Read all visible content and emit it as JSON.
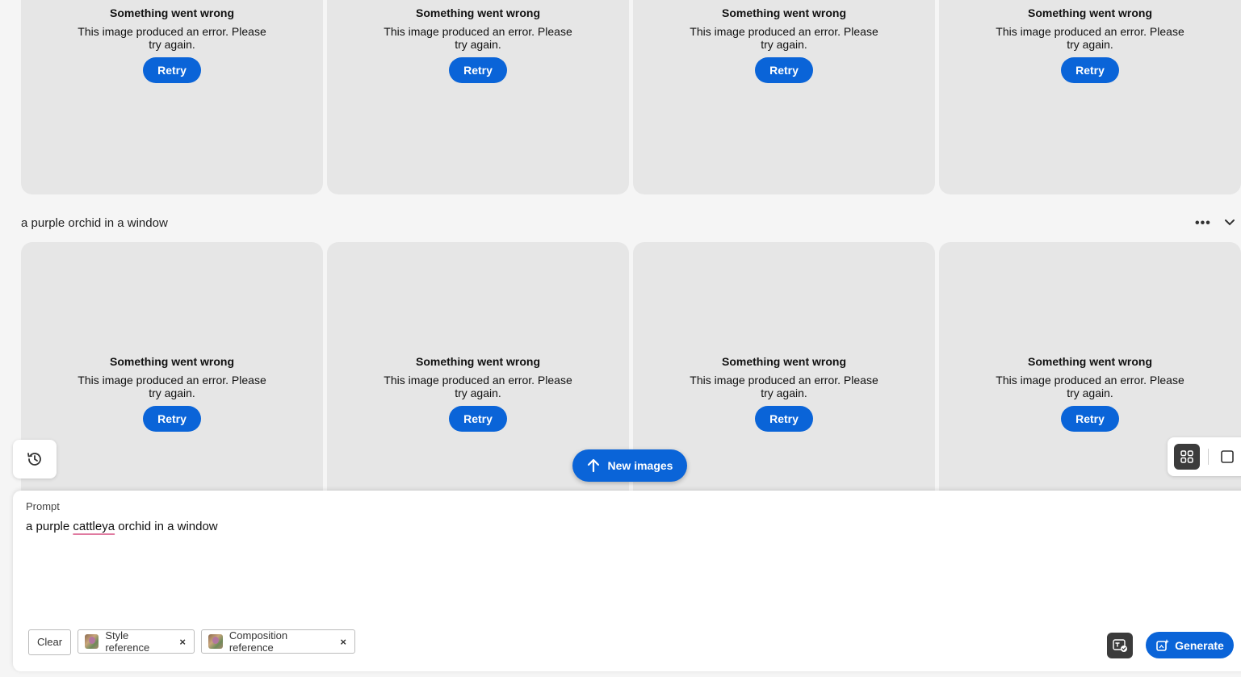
{
  "top_row": [
    {
      "title": "Something went wrong",
      "message": "This image produced an error. Please try again.",
      "action": "Retry"
    },
    {
      "title": "Something went wrong",
      "message": "This image produced an error. Please try again.",
      "action": "Retry"
    },
    {
      "title": "Something went wrong",
      "message": "This image produced an error. Please try again.",
      "action": "Retry"
    },
    {
      "title": "Something went wrong",
      "message": "This image produced an error. Please try again.",
      "action": "Retry"
    }
  ],
  "section": {
    "title": "a purple orchid in a window",
    "more_icon": "ellipsis-icon",
    "collapse_icon": "chevron-down-icon"
  },
  "bottom_row": [
    {
      "title": "Something went wrong",
      "message": "This image produced an error. Please try again.",
      "action": "Retry"
    },
    {
      "title": "Something went wrong",
      "message": "This image produced an error. Please try again.",
      "action": "Retry"
    },
    {
      "title": "Something went wrong",
      "message": "This image produced an error. Please try again.",
      "action": "Retry"
    },
    {
      "title": "Something went wrong",
      "message": "This image produced an error. Please try again.",
      "action": "Retry"
    }
  ],
  "floating": {
    "new_images_label": "New images",
    "history_icon": "history-icon",
    "grid_view_icon": "grid-view-icon",
    "single_view_icon": "single-view-icon"
  },
  "prompt": {
    "label": "Prompt",
    "text_before": "a purple ",
    "text_misspelled": "cattleya",
    "text_after": " orchid in a window",
    "clear_label": "Clear",
    "chips": [
      {
        "label": "Style reference",
        "remove": "×"
      },
      {
        "label": "Composition reference",
        "remove": "×"
      }
    ],
    "generate_label": "Generate"
  },
  "colors": {
    "accent": "#0a64d8",
    "card_bg": "#e6e6e6",
    "page_bg": "#f5f5f5"
  }
}
